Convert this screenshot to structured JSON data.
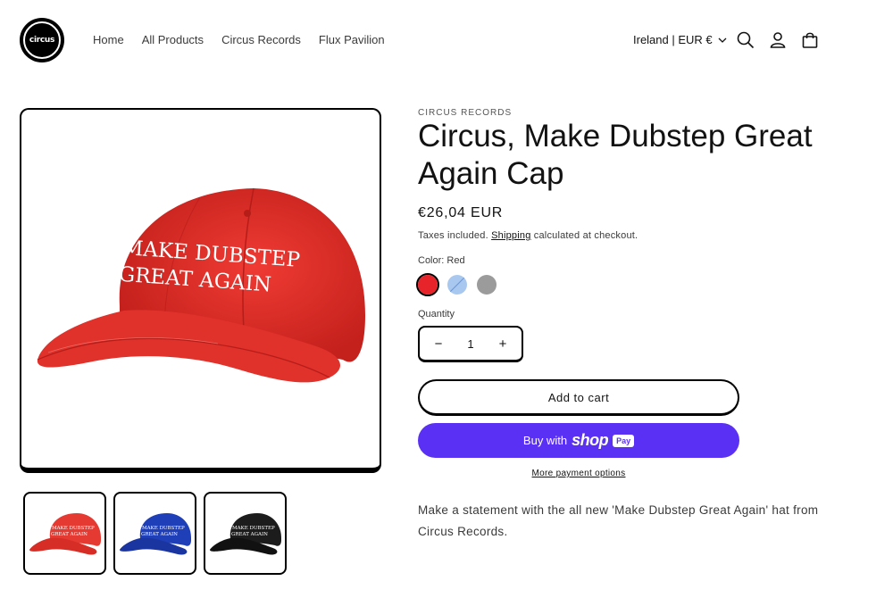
{
  "header": {
    "logo_text": "circus",
    "nav": [
      "Home",
      "All Products",
      "Circus Records",
      "Flux Pavilion"
    ],
    "locale": "Ireland | EUR €"
  },
  "product": {
    "vendor": "CIRCUS RECORDS",
    "title": "Circus, Make Dubstep Great Again Cap",
    "price": "€26,04 EUR",
    "tax_prefix": "Taxes included.",
    "tax_link": "Shipping",
    "tax_suffix": "calculated at checkout.",
    "color_label": "Color: Red",
    "swatches": [
      {
        "name": "Red",
        "color": "#e8242b"
      },
      {
        "name": "Blue",
        "color": "#a9c8ef"
      },
      {
        "name": "Black",
        "color": "#9b9b9b"
      }
    ],
    "quantity_label": "Quantity",
    "quantity_value": "1",
    "minus": "−",
    "plus": "+",
    "add_to_cart": "Add to cart",
    "buy_with": "Buy with",
    "shop": "shop",
    "pay": "Pay",
    "more_payment": "More payment options",
    "description": "Make a statement with the all new 'Make Dubstep Great Again' hat from Circus Records.",
    "cap_text_line1": "MAKE DUBSTEP",
    "cap_text_line2": "GREAT AGAIN",
    "thumb_colors": [
      "#e53a32",
      "#1f3fb8",
      "#1c1c1c"
    ]
  }
}
